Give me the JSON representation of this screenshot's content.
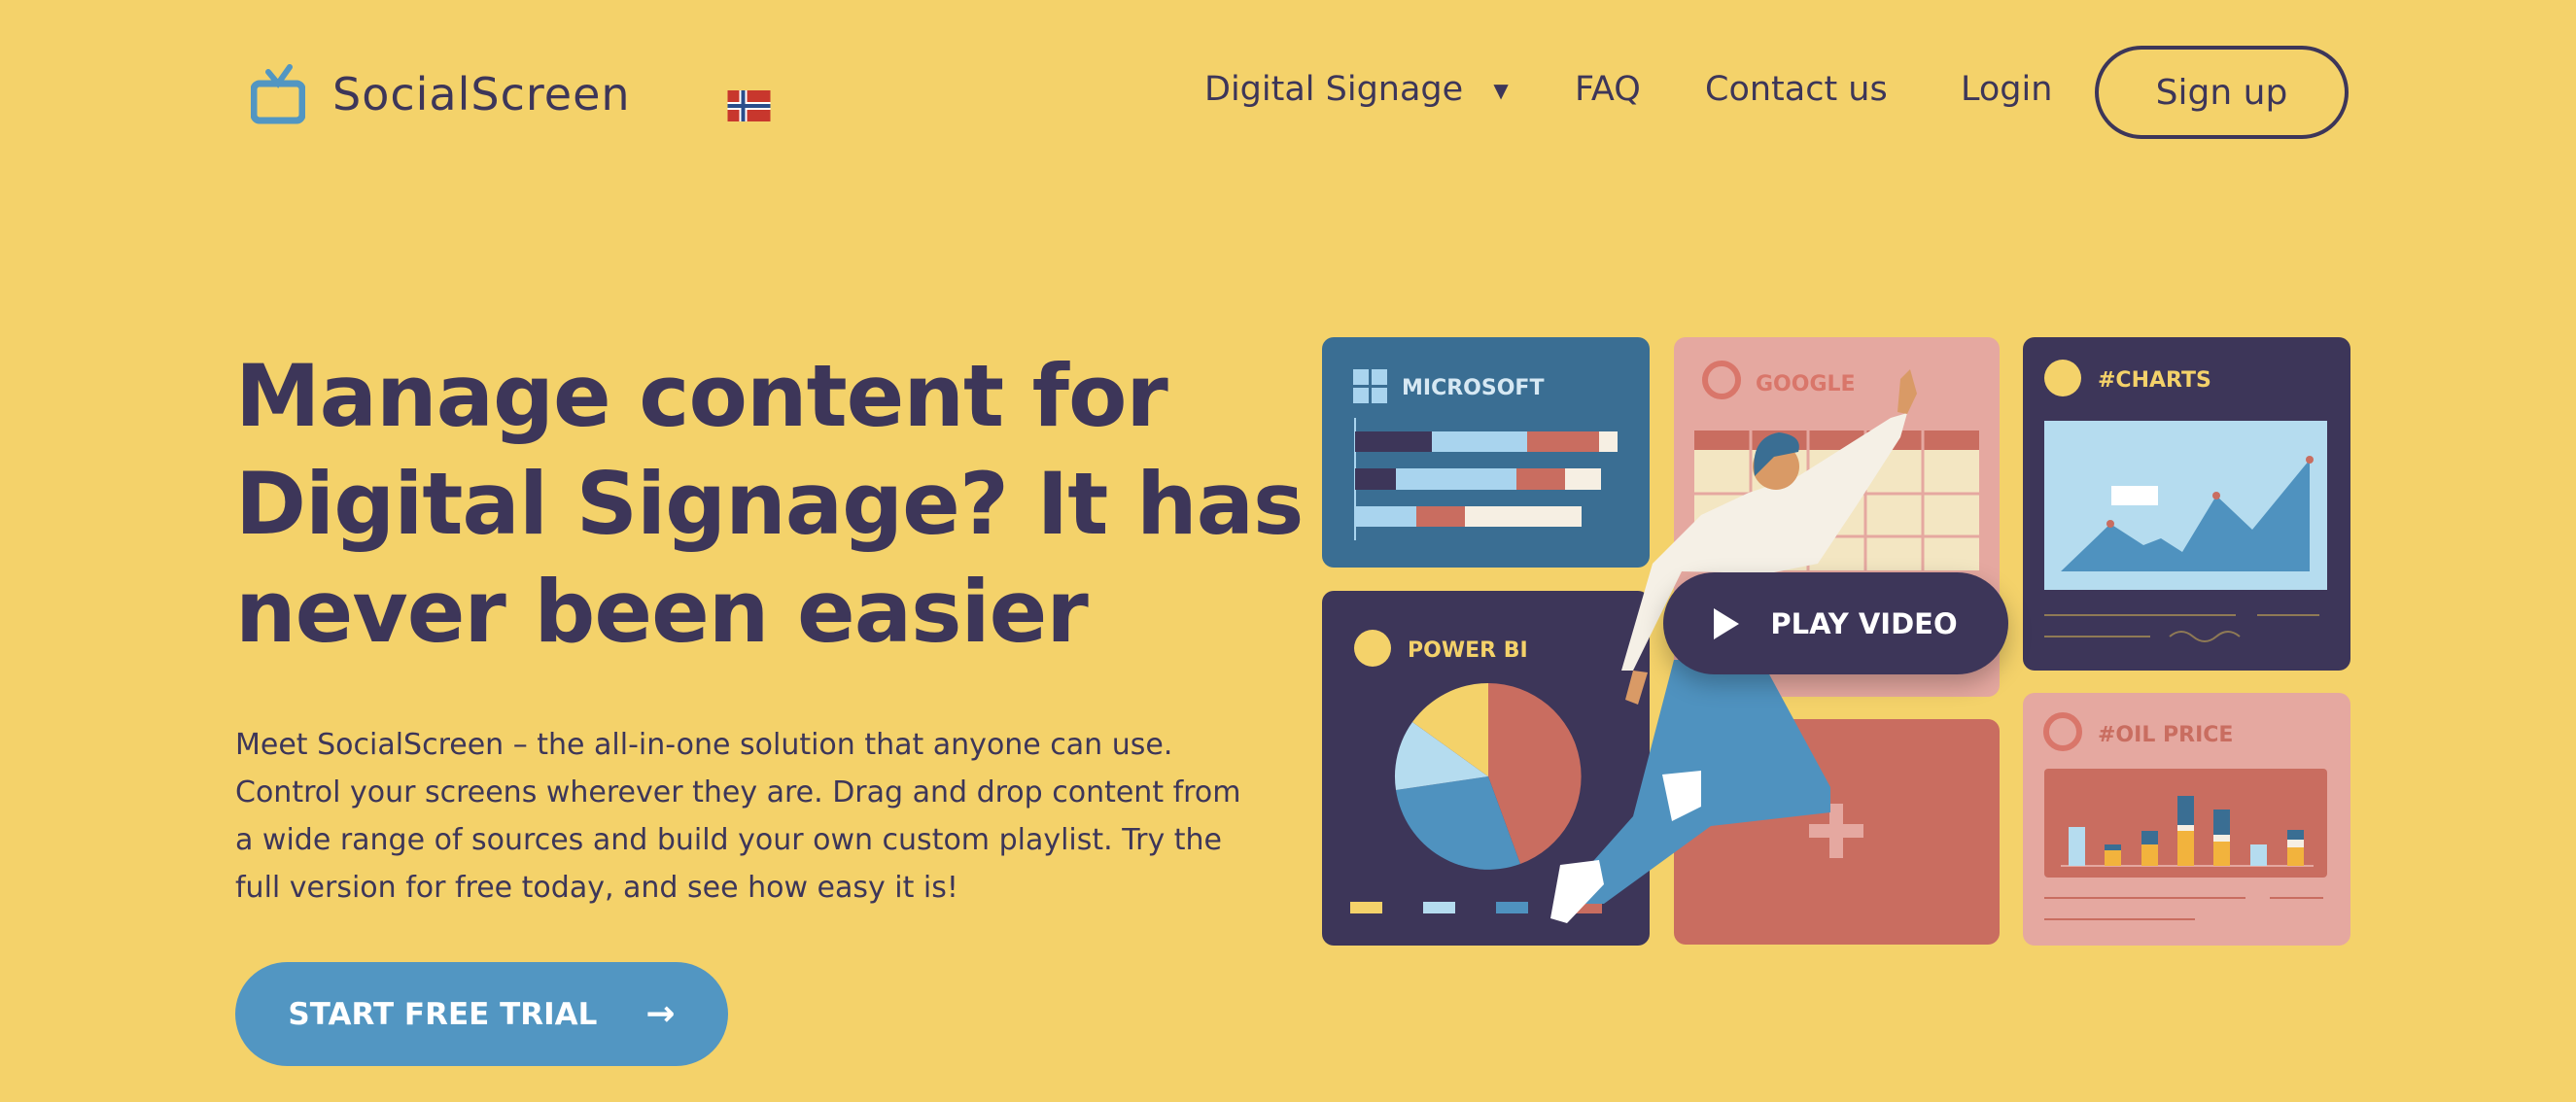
{
  "header": {
    "brand": "SocialScreen",
    "logo_icon": "tv-icon",
    "language_flag": "norway-flag-icon",
    "nav": [
      {
        "label": "Digital Signage",
        "icon": "caret-down-icon"
      },
      {
        "label": "FAQ"
      },
      {
        "label": "Contact us"
      },
      {
        "label": "Login"
      }
    ],
    "signup_label": "Sign up"
  },
  "hero": {
    "headline_lines": [
      "Manage content for",
      "Digital Signage? It has",
      "never been easier"
    ],
    "paragraph": "Meet SocialScreen – the all-in-one solution that anyone can use. Control your screens wherever they are. Drag and drop content from a wide range of sources and build your own custom playlist. Try the full version for free today, and see how easy it is!",
    "cta_label": "START FREE TRIAL",
    "cta_icon": "arrow-right-icon"
  },
  "illustration": {
    "cards": [
      "MICROSOFT",
      "GOOGLE",
      "#CHARTS",
      "POWER BI",
      "#OIL PRICE"
    ],
    "play_label": "PLAY VIDEO",
    "play_icon": "play-icon"
  },
  "colors": {
    "background": "#F4D26A",
    "text": "#3D3659",
    "accent_blue": "#5296C2",
    "card_blue": "#3A6E93",
    "card_pink": "#E5A8A0",
    "card_red": "#C96D60"
  }
}
